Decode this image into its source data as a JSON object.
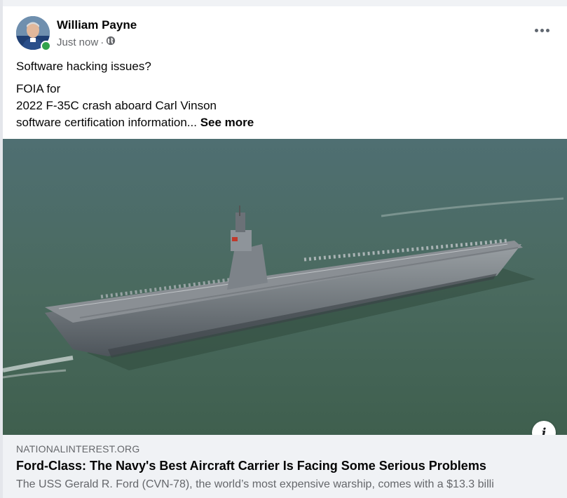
{
  "post": {
    "author": "William Payne",
    "timestamp": "Just now",
    "separator": "·",
    "privacy_icon": "globe-icon",
    "avatar_icon": "user-avatar",
    "line1": "Software hacking issues?",
    "line2": "FOIA for",
    "line3": "2022 F-35C crash aboard Carl Vinson",
    "line4": "software certification information...",
    "see_more": "See more",
    "more_options_icon": "more-horizontal-icon"
  },
  "link": {
    "domain": "NATIONALINTEREST.ORG",
    "title": "Ford-Class: The Navy's Best Aircraft Carrier Is Facing Some Serious Problems",
    "description": "The USS Gerald R. Ford (CVN-78), the world’s most expensive warship, comes with a $13.3 billi",
    "info_icon": "info-icon",
    "info_glyph": "i"
  },
  "colors": {
    "online": "#31a24c",
    "link_bg": "#f0f2f5",
    "sea": "#4a6b5c"
  }
}
